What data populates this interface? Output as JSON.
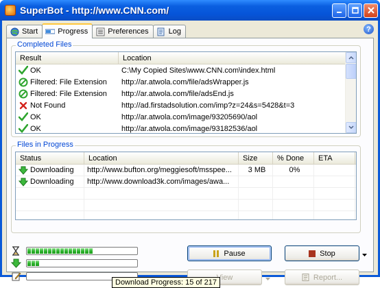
{
  "window": {
    "title": "SuperBot - http://www.CNN.com/"
  },
  "tabs": [
    {
      "label": "Start",
      "icon": "globe-icon"
    },
    {
      "label": "Progress",
      "icon": "progress-icon",
      "active": true
    },
    {
      "label": "Preferences",
      "icon": "preferences-icon"
    },
    {
      "label": "Log",
      "icon": "log-icon"
    }
  ],
  "completed": {
    "legend": "Completed Files",
    "columns": [
      "Result",
      "Location"
    ],
    "rows": [
      {
        "status": "ok",
        "result": "OK",
        "location": "C:\\My Copied Sites\\www.CNN.com\\index.html"
      },
      {
        "status": "filtered",
        "result": "Filtered: File Extension",
        "location": "http://ar.atwola.com/file/adsWrapper.js"
      },
      {
        "status": "filtered",
        "result": "Filtered: File Extension",
        "location": "http://ar.atwola.com/file/adsEnd.js"
      },
      {
        "status": "notfound",
        "result": "Not Found",
        "location": "http://ad.firstadsolution.com/imp?z=24&s=5428&t=3"
      },
      {
        "status": "ok",
        "result": "OK",
        "location": "http://ar.atwola.com/image/93205690/aol"
      },
      {
        "status": "ok",
        "result": "OK",
        "location": "http://ar.atwola.com/image/93182536/aol"
      }
    ]
  },
  "inprogress": {
    "legend": "Files in Progress",
    "columns": [
      "Status",
      "Location",
      "Size",
      "% Done",
      "ETA"
    ],
    "rows": [
      {
        "status": "Downloading",
        "location": "http://www.bufton.org/meggiesoft/msspee...",
        "size": "3 MB",
        "done": "0%",
        "eta": ""
      },
      {
        "status": "Downloading",
        "location": "http://www.download3k.com/images/awa...",
        "size": "",
        "done": "",
        "eta": ""
      }
    ]
  },
  "progress_bars": {
    "overall_segments_fraction": 0.63,
    "download_segments_fraction": 0.1,
    "edit_segments_fraction": 0
  },
  "buttons": {
    "pause": "Pause",
    "stop": "Stop",
    "view": "View",
    "report": "Report..."
  },
  "tooltip": "Download Progress: 15 of 217",
  "colors": {
    "accent": "#0046d5",
    "ok_green": "#2ea52e",
    "error_red": "#d3221c"
  }
}
